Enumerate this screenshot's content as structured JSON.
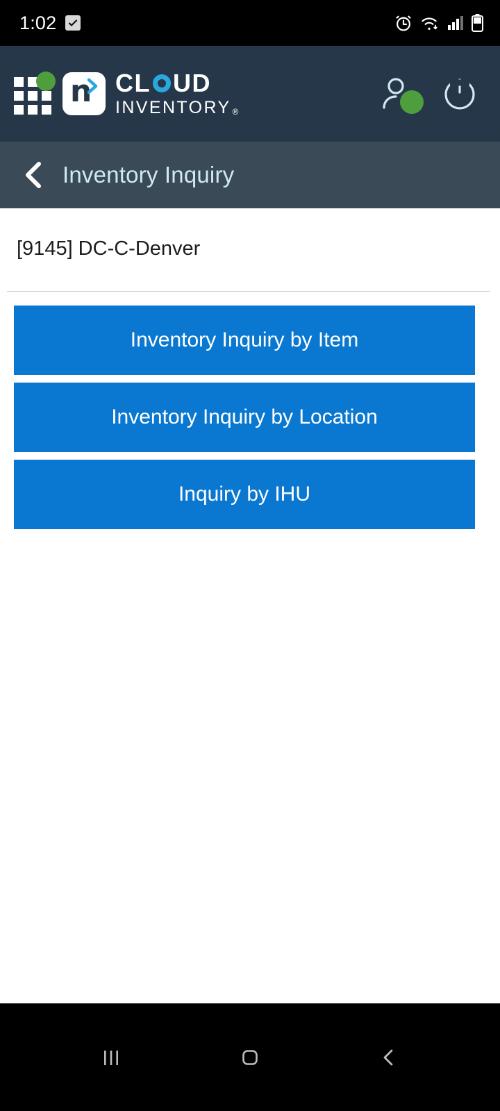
{
  "statusbar": {
    "time": "1:02",
    "icons": [
      "checkbox-app-icon",
      "alarm-icon",
      "wifi-icon",
      "signal-icon",
      "battery-icon"
    ]
  },
  "header": {
    "grid_icon": "app-grid-icon",
    "badge_letter": "n",
    "brand_line1": "CL",
    "brand_line1_b": "UD",
    "brand_line2": "INVENTORY",
    "brand_tm": "®",
    "user_icon": "user-account-icon",
    "power_icon": "power-icon",
    "bg_color": "#253748"
  },
  "navbar": {
    "back_icon": "back-chevron-icon",
    "title": "Inventory Inquiry",
    "bg_color": "#3b4a57",
    "title_color": "#cfe9f2"
  },
  "content": {
    "location": "[9145] DC-C-Denver",
    "buttons": [
      {
        "label": "Inventory Inquiry by Item"
      },
      {
        "label": "Inventory Inquiry by Location"
      },
      {
        "label": "Inquiry by IHU"
      }
    ],
    "button_color": "#0a78d0"
  },
  "systemnav": {
    "recents": "recents-icon",
    "home": "home-icon",
    "back": "android-back-icon"
  }
}
